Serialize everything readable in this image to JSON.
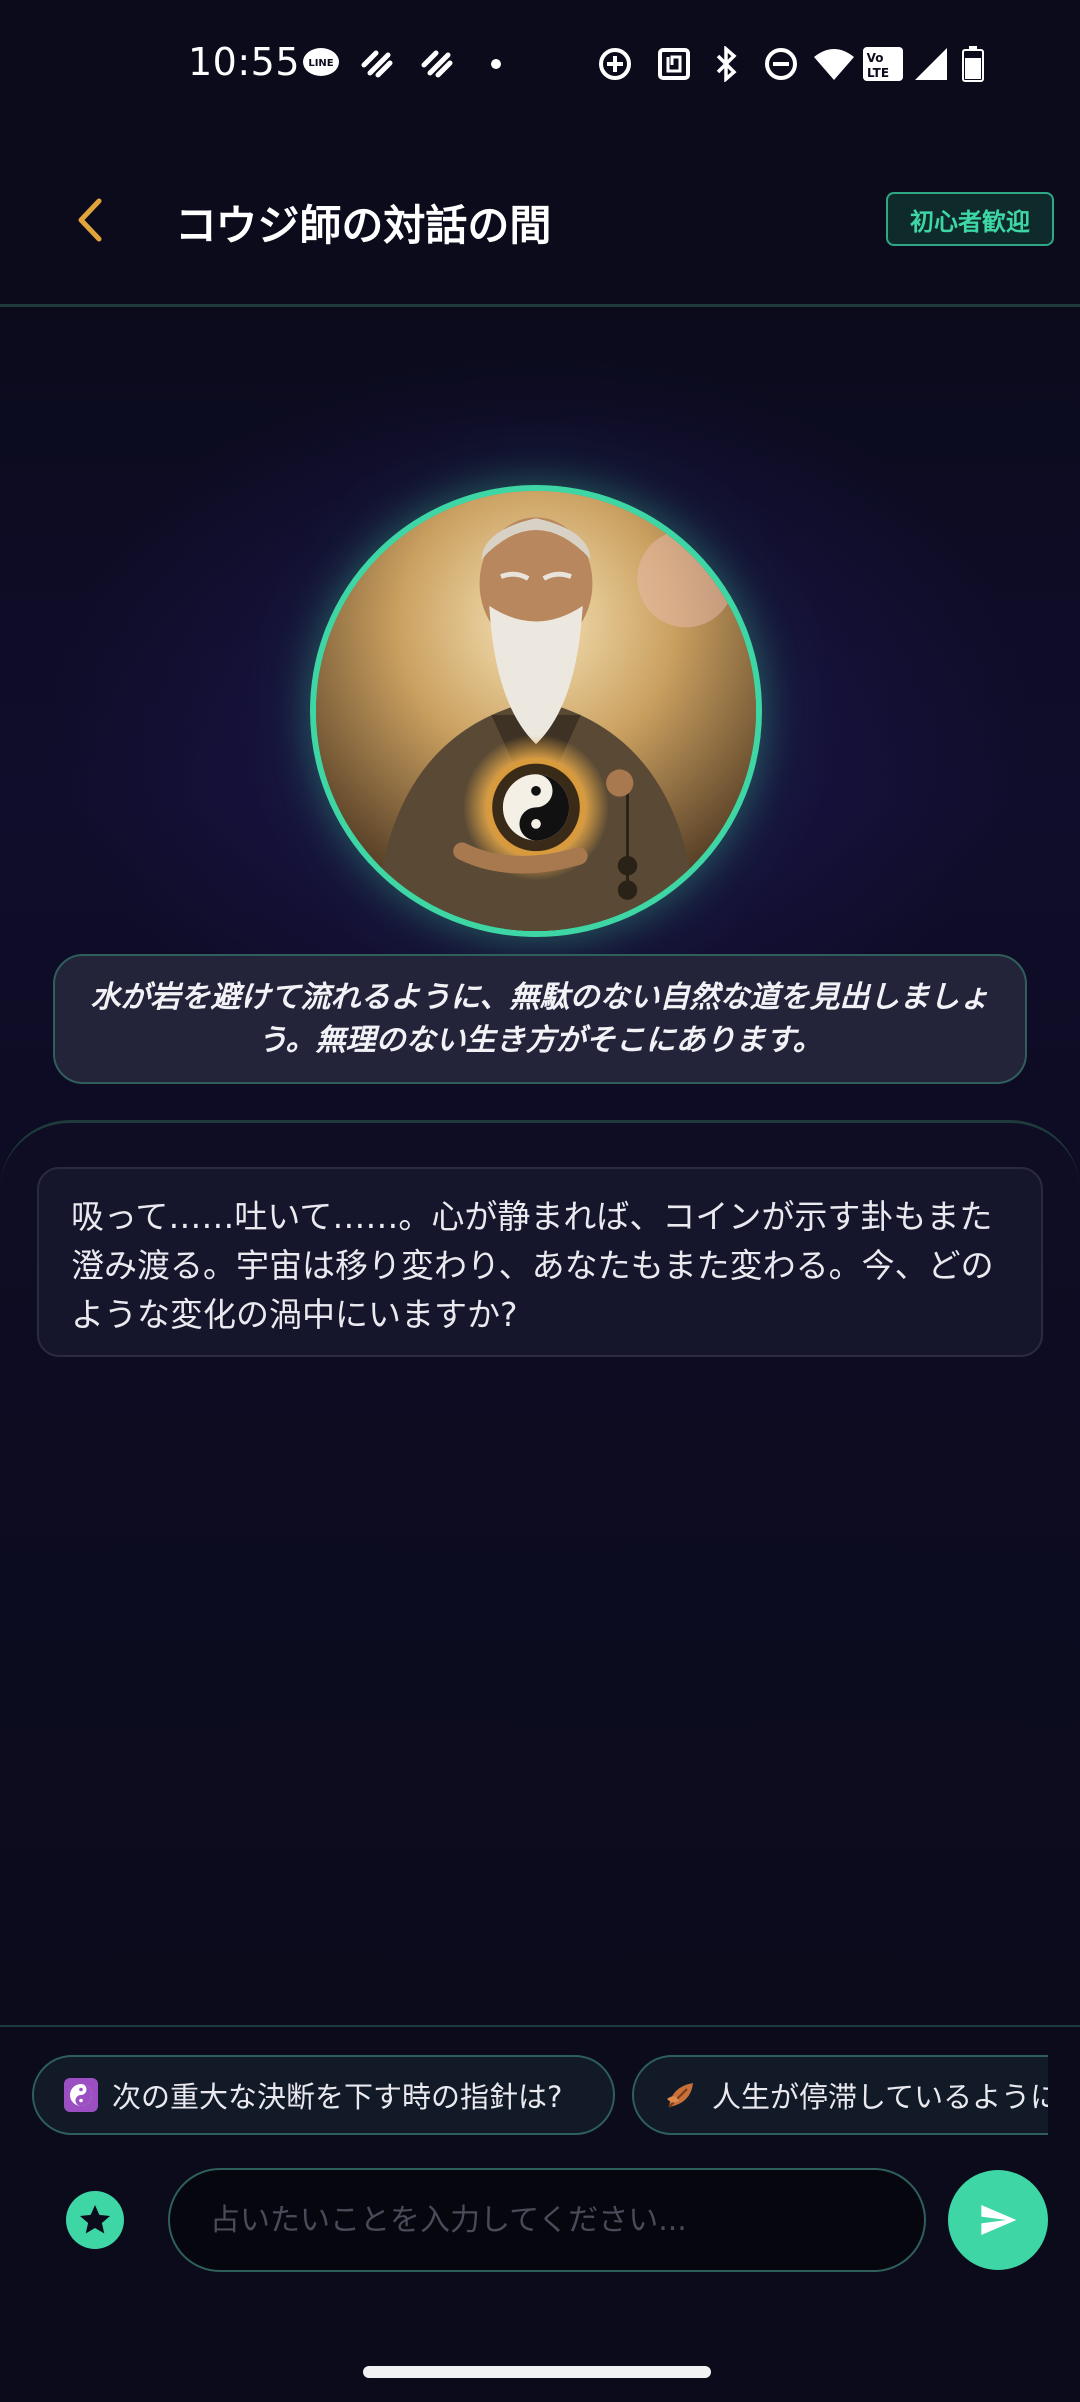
{
  "status_bar": {
    "time": "10:55",
    "notification_icons": [
      "line-icon",
      "app-icon",
      "app-icon",
      "dot-icon"
    ],
    "system_icons": [
      "data-saver-icon",
      "nfc-icon",
      "bluetooth-icon",
      "dnd-icon",
      "wifi-icon",
      "volte-icon",
      "signal-icon",
      "battery-icon"
    ],
    "volte_label": "Vo LTE"
  },
  "header": {
    "title": "コウジ師の対話の間",
    "badge": "初心者歓迎",
    "accent_color": "#e0a43a"
  },
  "hero": {
    "avatar_alt_icon": "sage-avatar",
    "quote": "水が岩を避けて流れるように、無駄のない自然な道を見出しましょう。無理のない生き方がそこにあります。"
  },
  "chat": {
    "messages": [
      {
        "role": "assistant",
        "text": "吸って……吐いて……。心が静まれば、コインが示す卦もまた澄み渡る。宇宙は移り変わり、あなたもまた変わる。今、どのような変化の渦中にいますか?"
      }
    ]
  },
  "suggestions": [
    {
      "icon": "yin-yang-icon",
      "label": "次の重大な決断を下す時の指針は?"
    },
    {
      "icon": "leaf-icon",
      "label": "人生が停滞しているように感じる"
    }
  ],
  "composer": {
    "placeholder": "占いたいことを入力してください...",
    "value": ""
  },
  "colors": {
    "accent": "#3ed6a4",
    "background": "#0c0b1e"
  }
}
